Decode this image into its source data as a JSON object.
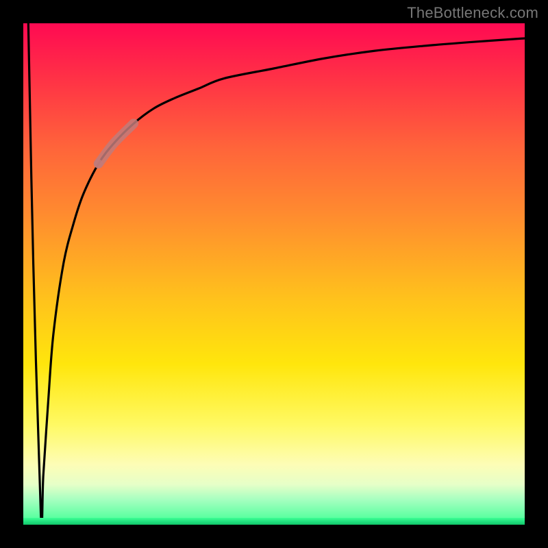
{
  "watermark": "TheBottleneck.com",
  "colors": {
    "frame": "#000000",
    "curve": "#000000",
    "highlight": "#c17b7a",
    "gradient_stops": [
      "#ff0a52",
      "#ff3545",
      "#ff653a",
      "#ff8b2f",
      "#ffc21c",
      "#ffe60c",
      "#fff963",
      "#fdfdb6",
      "#e6ffc8",
      "#a6ffc0",
      "#3dff94",
      "#12c66a"
    ]
  },
  "chart_data": {
    "type": "line",
    "title": "",
    "xlabel": "",
    "ylabel": "",
    "xlim": [
      0,
      100
    ],
    "ylim": [
      0,
      100
    ],
    "grid": false,
    "legend": false,
    "series": [
      {
        "name": "bottleneck-curve",
        "x": [
          1,
          2,
          3.5,
          4,
          5,
          6,
          8,
          10,
          12,
          15,
          18,
          22,
          26,
          30,
          35,
          40,
          50,
          60,
          70,
          80,
          90,
          100
        ],
        "y": [
          100,
          52,
          2,
          10,
          25,
          38,
          52,
          60,
          66,
          72,
          76,
          80,
          83,
          85,
          87,
          89,
          91,
          93,
          94.5,
          95.5,
          96.3,
          97
        ]
      }
    ],
    "highlight_segment": {
      "series": "bottleneck-curve",
      "x_range": [
        15,
        22
      ],
      "note": "thick pinkish-brown overlay on curve"
    }
  }
}
